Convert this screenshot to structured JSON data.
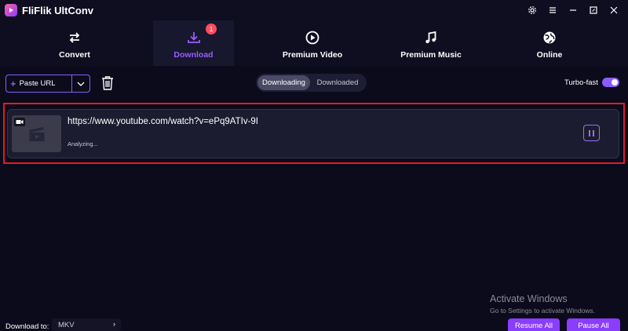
{
  "app": {
    "title": "FliFlik UltConv"
  },
  "nav": {
    "tabs": [
      {
        "label": "Convert",
        "icon": "convert-arrows-icon"
      },
      {
        "label": "Download",
        "icon": "download-icon",
        "badge": "1",
        "active": true
      },
      {
        "label": "Premium Video",
        "icon": "play-circle-icon"
      },
      {
        "label": "Premium Music",
        "icon": "music-note-icon"
      },
      {
        "label": "Online",
        "icon": "globe-icon"
      }
    ]
  },
  "toolbar": {
    "paste_url_label": "Paste URL",
    "segments": [
      "Downloading",
      "Downloaded"
    ],
    "active_segment": "Downloading",
    "turbo_label": "Turbo-fast",
    "turbo_on": true
  },
  "downloads": [
    {
      "url": "https://www.youtube.com/watch?v=ePq9ATIv-9I",
      "status": "Analyzing..."
    }
  ],
  "watermark": {
    "title": "Activate Windows",
    "subtitle": "Go to Settings to activate Windows."
  },
  "footer": {
    "download_to_label": "Download to:",
    "format": "MKV",
    "resume_all": "Resume All",
    "pause_all": "Pause All"
  },
  "colors": {
    "accent": "#8a3dff",
    "accent_light": "#9b5cff",
    "background": "#0b0b1c",
    "highlight": "#e01c24",
    "badge": "#ff4d5e"
  }
}
